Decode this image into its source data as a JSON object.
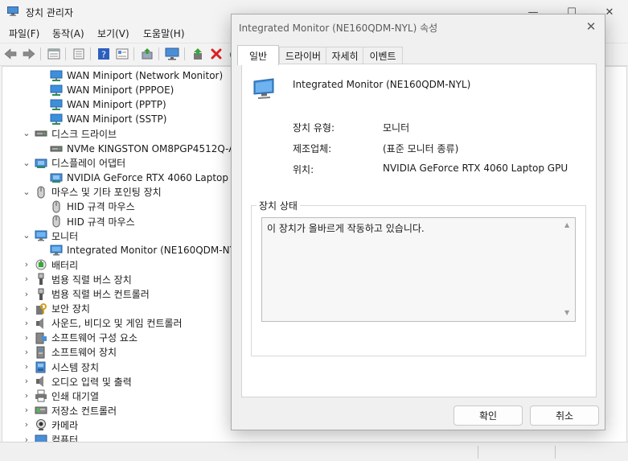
{
  "window": {
    "title": "장치 관리자",
    "controls": {
      "minimize": "—",
      "maximize": "☐",
      "close": "✕"
    }
  },
  "menu": [
    "파일(F)",
    "동작(A)",
    "보기(V)",
    "도움말(H)"
  ],
  "toolbar": [
    "back-icon",
    "forward-icon",
    "properties-view-icon",
    "list-view-icon",
    "help-icon",
    "details-view-icon",
    "update-driver-icon",
    "display-icon",
    "enable-device-icon",
    "uninstall-icon",
    "scan-hardware-icon"
  ],
  "tree": [
    {
      "label": "WAN Miniport (Network Monitor)",
      "level": 2,
      "icon": "network-adapter-icon"
    },
    {
      "label": "WAN Miniport (PPPOE)",
      "level": 2,
      "icon": "network-adapter-icon"
    },
    {
      "label": "WAN Miniport (PPTP)",
      "level": 2,
      "icon": "network-adapter-icon"
    },
    {
      "label": "WAN Miniport (SSTP)",
      "level": 2,
      "icon": "network-adapter-icon"
    },
    {
      "label": "디스크 드라이브",
      "level": 1,
      "expanded": true,
      "icon": "disk-drive-icon"
    },
    {
      "label": "NVMe KINGSTON OM8PGP4512Q-AA",
      "level": 2,
      "icon": "disk-drive-icon"
    },
    {
      "label": "디스플레이 어댑터",
      "level": 1,
      "expanded": true,
      "icon": "display-adapter-icon"
    },
    {
      "label": "NVIDIA GeForce RTX 4060 Laptop GP",
      "level": 2,
      "icon": "display-adapter-icon"
    },
    {
      "label": "마우스 및 기타 포인팅 장치",
      "level": 1,
      "expanded": true,
      "icon": "mouse-icon"
    },
    {
      "label": "HID 규격 마우스",
      "level": 2,
      "icon": "mouse-icon"
    },
    {
      "label": "HID 규격 마우스",
      "level": 2,
      "icon": "mouse-icon"
    },
    {
      "label": "모니터",
      "level": 1,
      "expanded": true,
      "icon": "monitor-icon"
    },
    {
      "label": "Integrated Monitor (NE160QDM-NYL)",
      "level": 2,
      "icon": "monitor-icon"
    },
    {
      "label": "배터리",
      "level": 1,
      "expanded": false,
      "icon": "battery-icon"
    },
    {
      "label": "범용 직렬 버스 장치",
      "level": 1,
      "expanded": false,
      "icon": "usb-icon"
    },
    {
      "label": "범용 직렬 버스 컨트롤러",
      "level": 1,
      "expanded": false,
      "icon": "usb-icon"
    },
    {
      "label": "보안 장치",
      "level": 1,
      "expanded": false,
      "icon": "security-device-icon"
    },
    {
      "label": "사운드, 비디오 및 게임 컨트롤러",
      "level": 1,
      "expanded": false,
      "icon": "speaker-icon"
    },
    {
      "label": "소프트웨어 구성 요소",
      "level": 1,
      "expanded": false,
      "icon": "software-component-icon"
    },
    {
      "label": "소프트웨어 장치",
      "level": 1,
      "expanded": false,
      "icon": "software-device-icon"
    },
    {
      "label": "시스템 장치",
      "level": 1,
      "expanded": false,
      "icon": "system-device-icon"
    },
    {
      "label": "오디오 입력 및 출력",
      "level": 1,
      "expanded": false,
      "icon": "speaker-icon"
    },
    {
      "label": "인쇄 대기열",
      "level": 1,
      "expanded": false,
      "icon": "printer-icon"
    },
    {
      "label": "저장소 컨트롤러",
      "level": 1,
      "expanded": false,
      "icon": "storage-controller-icon"
    },
    {
      "label": "카메라",
      "level": 1,
      "expanded": false,
      "icon": "camera-icon"
    },
    {
      "label": "컴퓨터",
      "level": 1,
      "expanded": false,
      "icon": "computer-icon"
    }
  ],
  "chevrons": {
    "expanded": "⌄",
    "collapsed": "›"
  },
  "dialog": {
    "title": "Integrated Monitor (NE160QDM-NYL) 속성",
    "close": "✕",
    "tabs": [
      "일반",
      "드라이버",
      "자세히",
      "이벤트"
    ],
    "device_name": "Integrated Monitor (NE160QDM-NYL)",
    "properties": [
      {
        "label": "장치 유형:",
        "value": "모니터"
      },
      {
        "label": "제조업체:",
        "value": "(표준 모니터 종류)"
      },
      {
        "label": "위치:",
        "value": "NVIDIA GeForce RTX 4060 Laptop GPU"
      }
    ],
    "status_title": "장치 상태",
    "status_text": "이 장치가 올바르게 작동하고 있습니다.",
    "scroll": {
      "up": "▲",
      "down": "▼"
    },
    "ok_label": "확인",
    "cancel_label": "취소"
  }
}
